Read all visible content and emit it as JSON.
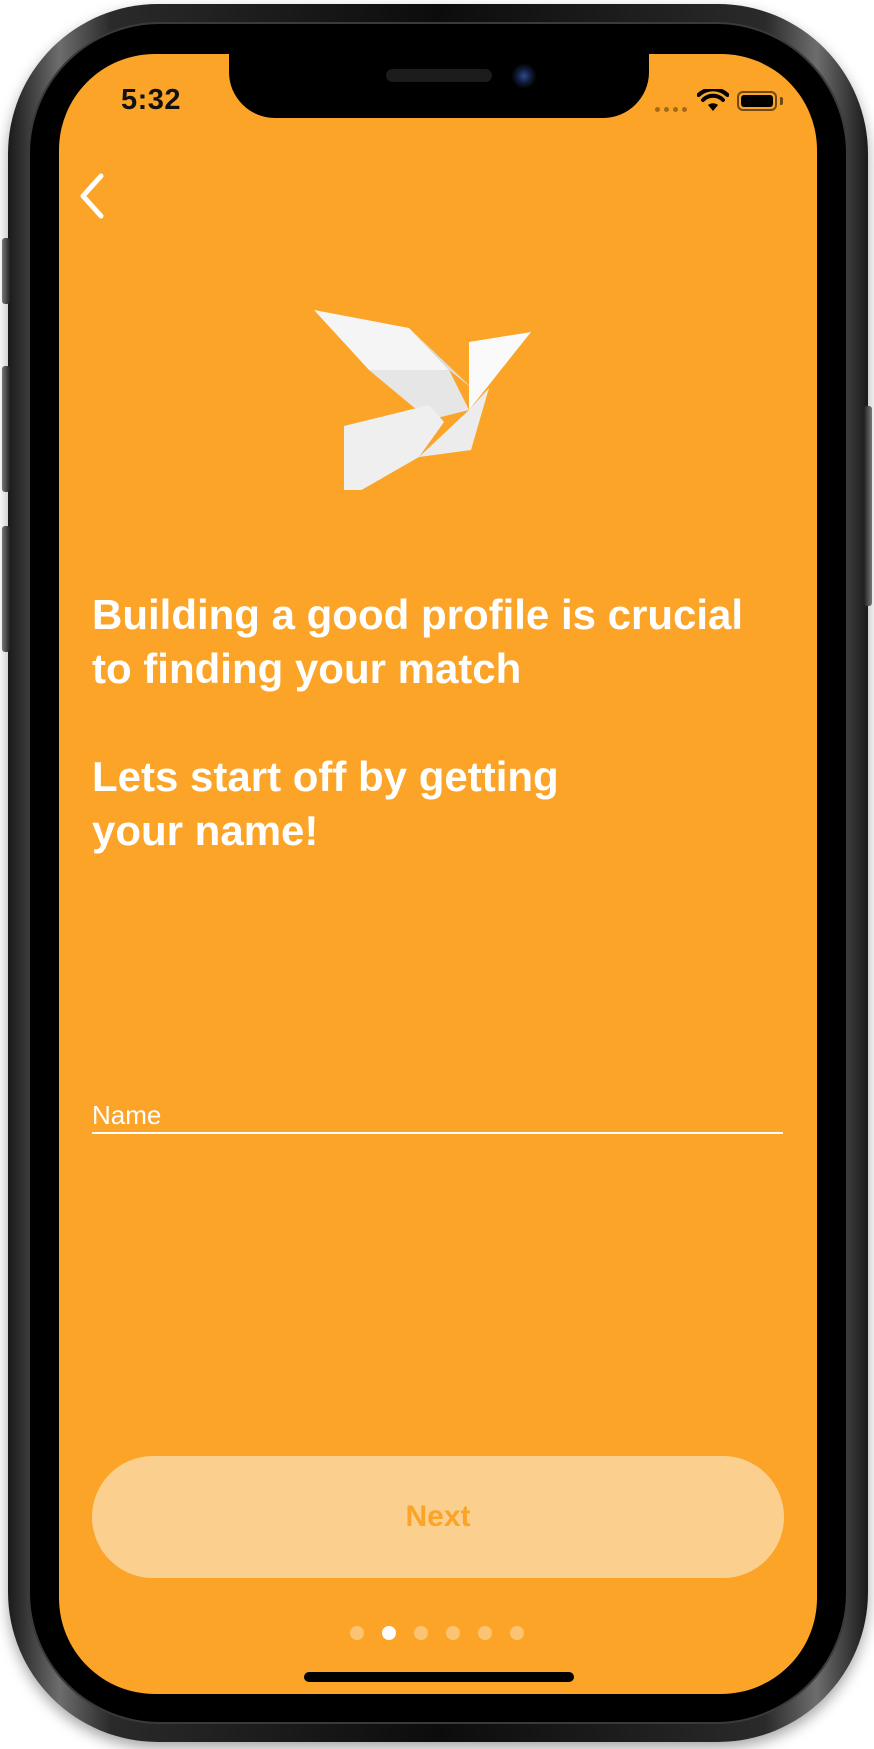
{
  "status_bar": {
    "time": "5:32"
  },
  "onboarding": {
    "heading_line1": "Building a good profile is crucial to finding your match",
    "heading_line2": "Lets start off by getting your name!",
    "name_field": {
      "placeholder": "Name",
      "value": ""
    },
    "next_label": "Next",
    "pagination": {
      "current": 2,
      "total": 6
    }
  },
  "icons": {
    "back": "chevron-left-icon",
    "logo": "origami-bird-icon",
    "wifi": "wifi-icon",
    "battery": "battery-icon"
  },
  "colors": {
    "background": "#FBA428",
    "text": "#FFFFFF",
    "button_bg": "#FBD08F",
    "button_text": "#FBA428",
    "status_text": "#111111"
  }
}
